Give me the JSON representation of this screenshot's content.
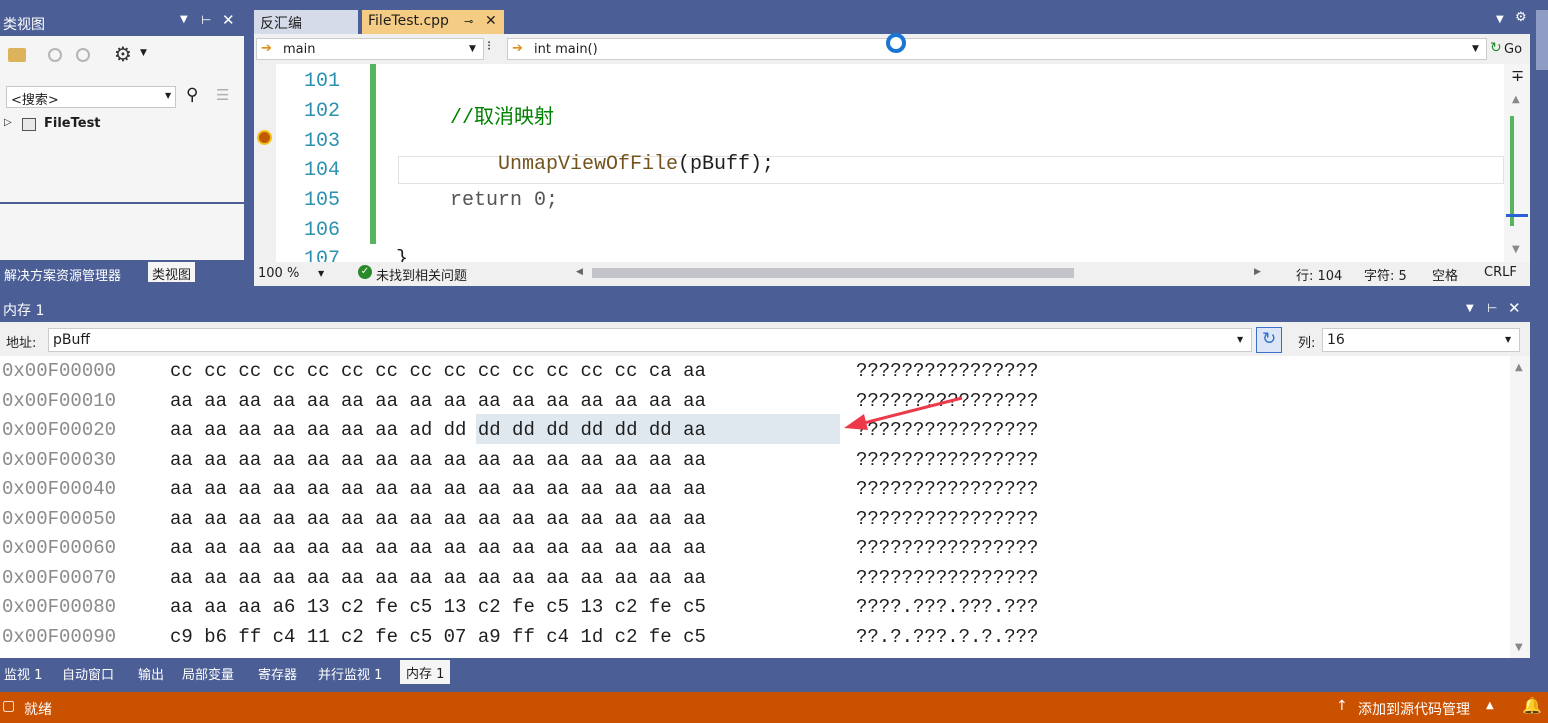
{
  "colors": {
    "frame_blue": "#4b5f96",
    "tab_active": "#f5cc84",
    "tab_inactive": "#d6dbe9",
    "status_orange": "#ca5100",
    "comment_green": "#008000",
    "function_brown": "#74531f",
    "highlight": "#dfe8ef",
    "arrow_red": "#ec3a4a"
  },
  "class_view": {
    "title": "类视图",
    "search_placeholder": "<搜索>",
    "tree_item": "FileTest",
    "bottom_tabs": [
      "解决方案资源管理器",
      "类视图"
    ]
  },
  "editor": {
    "tabs": [
      {
        "label": "反汇编",
        "active": false
      },
      {
        "label": "FileTest.cpp",
        "active": true
      }
    ],
    "scope_dropdown": "main",
    "function_dropdown": "int main()",
    "go_label": "Go",
    "line_numbers": [
      "101",
      "102",
      "103",
      "104",
      "105",
      "106",
      "107"
    ],
    "lines": {
      "l102": "//取消映射",
      "l103_func": "UnmapViewOfFile",
      "l103_rest": "(pBuff);",
      "l105": "return 0;",
      "l107": "}"
    },
    "zoom": "100 %",
    "issues": "未找到相关问题",
    "row_label": "行: 104",
    "char_label": "字符: 5",
    "spacing_label": "空格",
    "eol_label": "CRLF"
  },
  "memory": {
    "title": "内存 1",
    "address_label": "地址:",
    "address_value": "pBuff",
    "columns_label": "列:",
    "columns_value": "16",
    "rows": [
      {
        "addr": "0x00F00000",
        "bytes": "cc cc cc cc cc cc cc cc cc cc cc cc cc cc ca aa",
        "ascii": "????????????????"
      },
      {
        "addr": "0x00F00010",
        "bytes": "aa aa aa aa aa aa aa aa aa aa aa aa aa aa aa aa",
        "ascii": "????????????????"
      },
      {
        "addr": "0x00F00020",
        "bytes_pre": "aa aa aa aa aa aa aa a",
        "bytes_hl": "d dd dd dd dd dd dd dd aa",
        "ascii": "????????????????"
      },
      {
        "addr": "0x00F00030",
        "bytes": "aa aa aa aa aa aa aa aa aa aa aa aa aa aa aa aa",
        "ascii": "????????????????"
      },
      {
        "addr": "0x00F00040",
        "bytes": "aa aa aa aa aa aa aa aa aa aa aa aa aa aa aa aa",
        "ascii": "????????????????"
      },
      {
        "addr": "0x00F00050",
        "bytes": "aa aa aa aa aa aa aa aa aa aa aa aa aa aa aa aa",
        "ascii": "????????????????"
      },
      {
        "addr": "0x00F00060",
        "bytes": "aa aa aa aa aa aa aa aa aa aa aa aa aa aa aa aa",
        "ascii": "????????????????"
      },
      {
        "addr": "0x00F00070",
        "bytes": "aa aa aa aa aa aa aa aa aa aa aa aa aa aa aa aa",
        "ascii": "????????????????"
      },
      {
        "addr": "0x00F00080",
        "bytes": "aa aa aa a6 13 c2 fe c5 13 c2 fe c5 13 c2 fe c5",
        "ascii": "????.???.???.???"
      },
      {
        "addr": "0x00F00090",
        "bytes": "c9 b6 ff c4 11 c2 fe c5 07 a9 ff c4 1d c2 fe c5",
        "ascii": "??.?.???.?.?.???"
      }
    ]
  },
  "bottom_tabs": [
    "监视 1",
    "自动窗口",
    "输出",
    "局部变量",
    "寄存器",
    "并行监视 1",
    "内存 1"
  ],
  "status_bar": {
    "ready": "就绪",
    "source_control": "添加到源代码管理"
  },
  "icons": [
    "folder-icon",
    "back-icon",
    "forward-icon",
    "gear-icon",
    "search-icon",
    "pin-icon",
    "close-icon",
    "breakpoint-arrow-icon",
    "refresh-icon",
    "go-icon",
    "split-icon"
  ]
}
